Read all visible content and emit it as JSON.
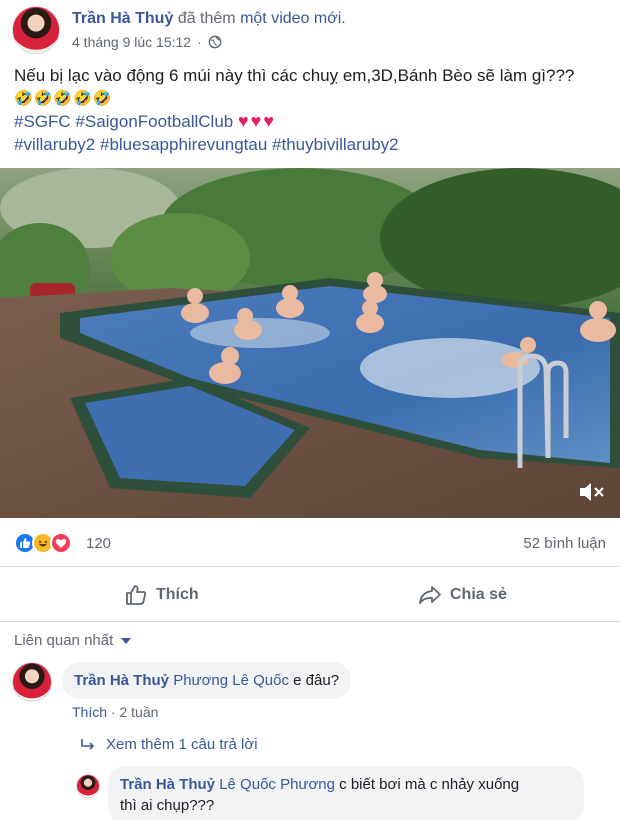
{
  "post": {
    "author": "Trần Hà Thuỷ",
    "action_prefix": "đã thêm",
    "action_link": "một video mới.",
    "timestamp": "4 tháng 9 lúc 15:12",
    "separator": "·",
    "text_line1": "Nếu bị lạc vào động 6 múi này thì các chuỵ em,3D,Bánh Bèo sẽ làm gì???",
    "emojis": "🤣🤣🤣🤣🤣",
    "hashtags_line1": "#SGFC #SaigonFootballClub",
    "hearts": "♥♥♥",
    "hashtags_line2": "#villaruby2 #bluesapphirevungtau #thuybivillaruby2"
  },
  "reactions": {
    "count": "120",
    "comments": "52 bình luận"
  },
  "actions": {
    "like_label": "Thích",
    "share_label": "Chia sẻ"
  },
  "comments_section": {
    "sort_label": "Liên quan nhất",
    "comment1": {
      "author": "Trần Hà Thuỷ",
      "mention": "Phương Lê Quốc",
      "text": "e đâu?",
      "like_label": "Thích",
      "separator": "·",
      "age": "2 tuần"
    },
    "replies_link": "Xem thêm 1 câu trả lời",
    "reply1": {
      "author": "Trần Hà Thuỷ",
      "mention": "Lê Quốc Phương",
      "text_line1": "c biết bơi mà c nhảy xuống",
      "text_line2": "thì ai chụp???"
    }
  },
  "colors": {
    "link": "#385898",
    "like_blue": "#1877f2",
    "love_red": "#f33e58",
    "haha_yellow": "#f7b928"
  },
  "icons": [
    "globe-icon",
    "like-icon",
    "haha-icon",
    "love-icon",
    "thumbs-up-icon",
    "share-arrow-icon",
    "mute-icon",
    "reply-arrow-icon"
  ]
}
